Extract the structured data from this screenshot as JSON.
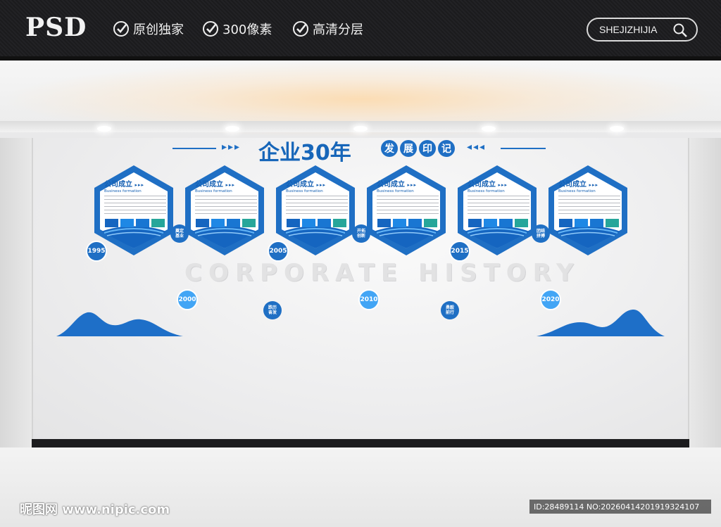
{
  "header": {
    "logo": "PSD",
    "features": [
      {
        "label": "原创独家",
        "icon": "check-circle-icon"
      },
      {
        "label": "300像素",
        "icon": "check-circle-icon"
      },
      {
        "label": "高清分层",
        "icon": "check-circle-icon"
      }
    ],
    "search_label": "SHEJIZHIJIA",
    "search_icon": "magnifier-icon"
  },
  "exhibit": {
    "title_main": "企业30年",
    "title_sub": [
      "发",
      "展",
      "印",
      "记"
    ],
    "arrows_left": "▸▸▸",
    "arrows_right": "◂◂◂",
    "watermark_text": "CORPORATE HISTORY",
    "accent": "#1f6fc4",
    "cards": [
      {
        "title": "公司成立",
        "arrows": "▸▸▸",
        "subtitle": "Business formation"
      },
      {
        "title": "公司成立",
        "arrows": "▸▸▸",
        "subtitle": "Business formation"
      },
      {
        "title": "公司成立",
        "arrows": "▸▸▸",
        "subtitle": "Business formation"
      },
      {
        "title": "公司成立",
        "arrows": "▸▸▸",
        "subtitle": "Business formation"
      },
      {
        "title": "公司成立",
        "arrows": "▸▸▸",
        "subtitle": "Business formation"
      },
      {
        "title": "公司成立",
        "arrows": "▸▸▸",
        "subtitle": "Business formation"
      }
    ],
    "years": [
      "1995",
      "2000",
      "2005",
      "2010",
      "2015",
      "2020"
    ],
    "tags": [
      "奠定\n基业",
      "跌历\n奋发",
      "开拓\n创新",
      "勇毅\n前行",
      "团结\n拼搏"
    ],
    "swatch_colors": [
      "#1565c0",
      "#1e88e5",
      "#1976d2",
      "#26a69a"
    ]
  },
  "footer": {
    "site_watermark": "昵图网 www.nipic.com",
    "id_text": "ID:28489114 NO:20260414201919324107"
  }
}
